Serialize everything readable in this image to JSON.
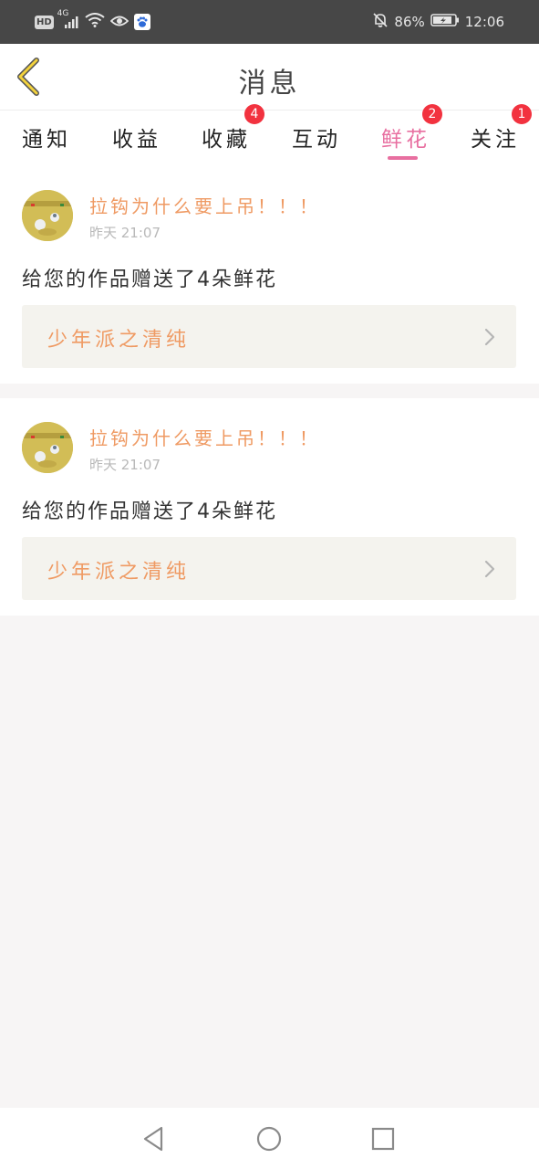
{
  "status_bar": {
    "hd_badge": "HD",
    "network": "4G",
    "battery": "86%",
    "time": "12:06",
    "icons": [
      "signal-icon",
      "wifi-icon",
      "eye-icon",
      "baidu-icon",
      "bell-off-icon",
      "battery-icon"
    ]
  },
  "header": {
    "title": "消息",
    "back_icon": "chevron-left-icon"
  },
  "tabs": [
    {
      "label": "通知",
      "badge": ""
    },
    {
      "label": "收益",
      "badge": ""
    },
    {
      "label": "收藏",
      "badge": "4"
    },
    {
      "label": "互动",
      "badge": ""
    },
    {
      "label": "鲜花",
      "badge": "2",
      "active": true
    },
    {
      "label": "关注",
      "badge": "1"
    }
  ],
  "messages": [
    {
      "sender": "拉钩为什么要上吊！！！",
      "time": "昨天 21:07",
      "text": "给您的作品赠送了4朵鲜花",
      "work_title": "少年派之清纯"
    },
    {
      "sender": "拉钩为什么要上吊！！！",
      "time": "昨天 21:07",
      "text": "给您的作品赠送了4朵鲜花",
      "work_title": "少年派之清纯"
    }
  ],
  "colors": {
    "accent": "#e86fa0",
    "sender": "#ef9a63",
    "badge": "#f2323f",
    "work_box_bg": "#f4f3ee"
  },
  "nav_bar": {
    "icons": [
      "back-triangle-icon",
      "home-circle-icon",
      "recents-square-icon"
    ]
  }
}
